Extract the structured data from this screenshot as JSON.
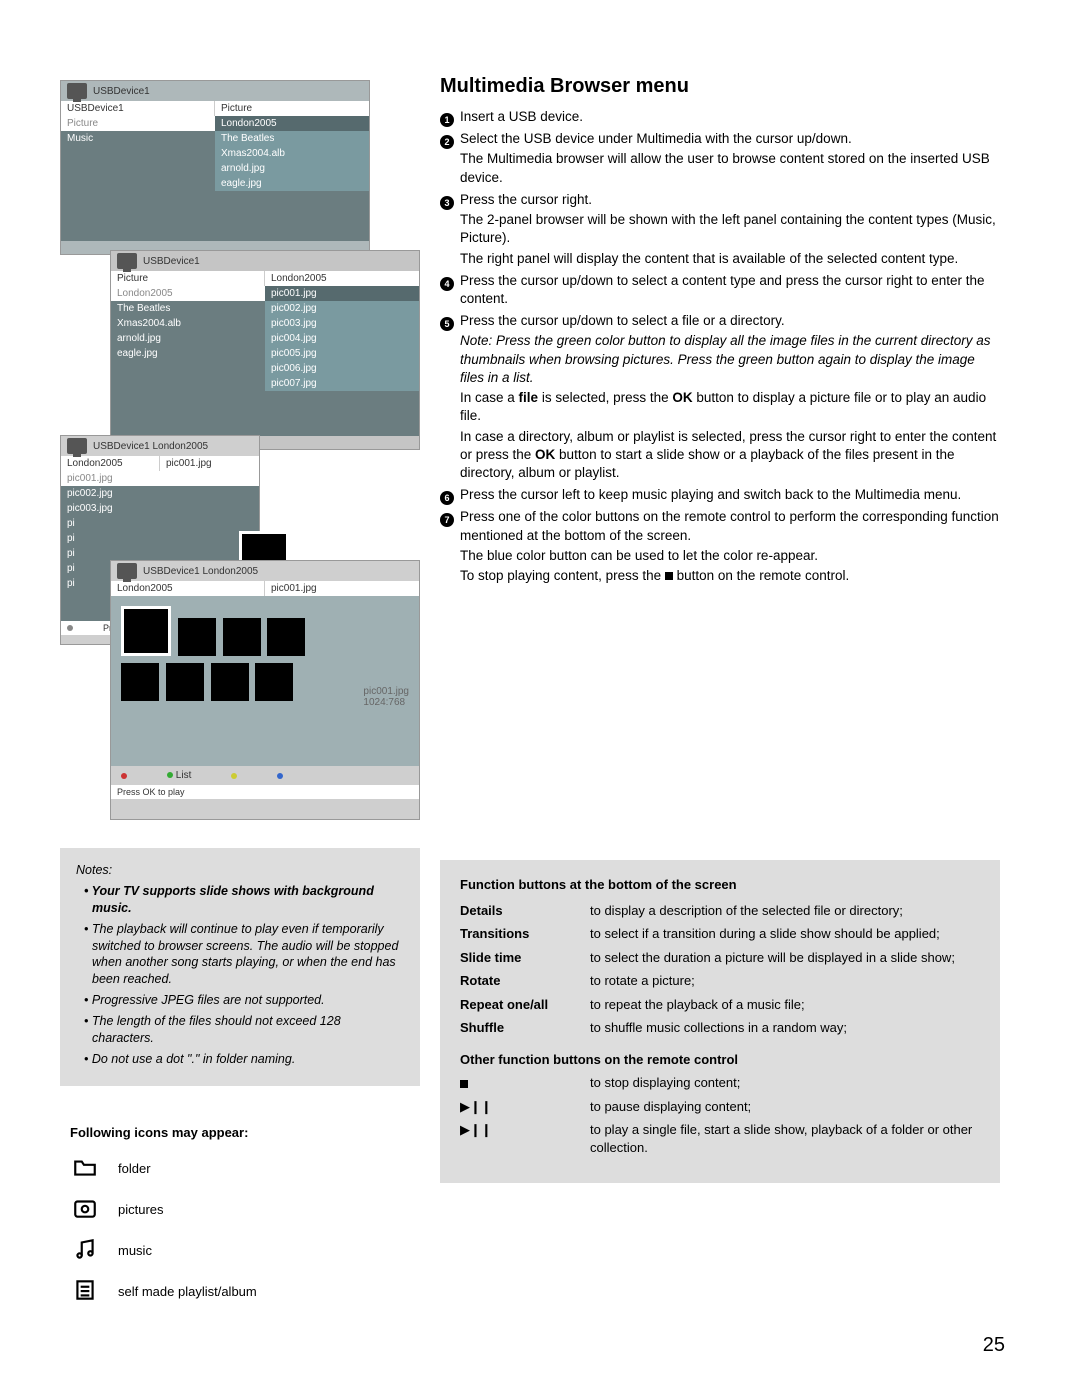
{
  "page_number": "25",
  "title": "Multimedia Browser menu",
  "panels": {
    "p1": {
      "breadcrumb": "USBDevice1",
      "colA": "USBDevice1",
      "colB": "Picture",
      "left": [
        "Picture",
        "Music"
      ],
      "right": [
        "London2005",
        "The Beatles",
        "Xmas2004.alb",
        "arnold.jpg",
        "eagle.jpg"
      ]
    },
    "p2": {
      "breadcrumb": "USBDevice1",
      "colA": "Picture",
      "colB": "London2005",
      "left": [
        "London2005",
        "The Beatles",
        "Xmas2004.alb",
        "arnold.jpg",
        "eagle.jpg"
      ],
      "right": [
        "pic001.jpg",
        "pic002.jpg",
        "pic003.jpg",
        "pic004.jpg",
        "pic005.jpg",
        "pic006.jpg",
        "pic007.jpg"
      ]
    },
    "p3": {
      "breadcrumb": "USBDevice1 London2005",
      "colA": "London2005",
      "colB": "pic001.jpg",
      "left": [
        "pic001.jpg",
        "pic002.jpg",
        "pic003.jpg",
        "pi",
        "pi",
        "pi",
        "pi",
        "pi"
      ],
      "footer": "Press"
    },
    "p4": {
      "breadcrumb": "USBDevice1 London2005",
      "colA": "London2005",
      "colB": "pic001.jpg",
      "meta1": "pic001.jpg",
      "meta2": "1024:768",
      "btn": "List",
      "footer": "Press OK to play"
    }
  },
  "steps": {
    "s1": "Insert a USB device.",
    "s2a": "Select the USB device under Multimedia with the cursor up/down.",
    "s2b": "The Multimedia browser will allow the user to browse content stored on the inserted USB device.",
    "s3a": "Press the cursor right.",
    "s3b": "The 2-panel browser will be shown with the left panel containing the content types (Music, Picture).",
    "s3c": "The right panel will display the content that is available of the selected content type.",
    "s4": "Press the cursor up/down to select a content type and press the cursor right to enter the content.",
    "s5a": "Press the cursor up/down to select a file or a directory.",
    "s5note": "Note: Press the green color button to display all the image files in the current directory as thumbnails when browsing pictures. Press the green button again to display the image files in a list.",
    "s5b_pre": "In case a ",
    "s5b_bold": "file",
    "s5b_mid": " is selected, press the ",
    "s5b_ok": "OK",
    "s5b_post": " button to display a picture file or to play an audio file.",
    "s5c_pre": "In case a directory, album or playlist is selected, press the cursor right to enter the content or press the ",
    "s5c_ok": "OK",
    "s5c_post": " button to start a slide show or a playback of the files present in the directory, album or playlist.",
    "s6": "Press the cursor left to keep music playing and switch back to the Multimedia menu.",
    "s7a": "Press one of the color buttons on the remote control to perform the corresponding function mentioned at the bottom of the screen.",
    "s7b": "The blue color button can be used to let the color re-appear.",
    "s_stop_pre": "To stop playing content, press the ",
    "s_stop_post": " button on the remote control."
  },
  "func": {
    "heading": "Function buttons at the bottom of the screen",
    "rows": [
      {
        "lbl": "Details",
        "desc": "to display a description of the selected file or directory;"
      },
      {
        "lbl": "Transitions",
        "desc": "to select if a transition during a slide show should be applied;"
      },
      {
        "lbl": "Slide time",
        "desc": "to select the duration a picture will be displayed in a slide show;"
      },
      {
        "lbl": "Rotate",
        "desc": "to rotate a picture;"
      },
      {
        "lbl": "Repeat one/all",
        "desc": "to repeat the playback of a music file;"
      },
      {
        "lbl": "Shuffle",
        "desc": "to shuffle music collections in a random way;"
      }
    ],
    "heading2": "Other function buttons on the remote control",
    "rows2": [
      {
        "sym": "■",
        "desc": "to stop displaying content;"
      },
      {
        "sym": "▶❙❙",
        "desc": "to pause displaying content;"
      },
      {
        "sym": "▶❙❙",
        "desc": "to play a single file, start a slide show, playback of a folder or other collection."
      }
    ]
  },
  "notes": {
    "hdr": "Notes:",
    "items": [
      {
        "b": true,
        "t": "Your TV supports slide shows with background music."
      },
      {
        "b": false,
        "t": "The playback will continue to play even if temporarily switched to browser screens. The audio will be stopped when another song starts playing, or when the end has been reached."
      },
      {
        "b": false,
        "t": "Progressive JPEG files are not supported."
      },
      {
        "b": false,
        "t": "The length of the files should not exceed 128 characters."
      },
      {
        "b": false,
        "t": "Do not use a dot \".\" in folder naming."
      }
    ]
  },
  "icons": {
    "heading": "Following icons may appear:",
    "items": [
      "folder",
      "pictures",
      "music",
      "self made playlist/album"
    ]
  }
}
